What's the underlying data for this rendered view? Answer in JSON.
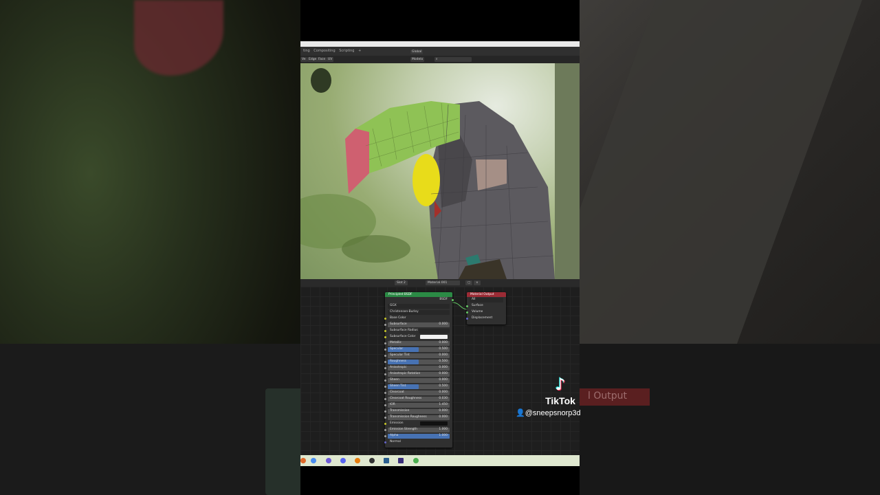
{
  "menubar": {
    "items": [
      "ting",
      "Compositing",
      "Scripting",
      "+"
    ]
  },
  "header": {
    "orientation": "Global",
    "snap": "Modelo",
    "modes": [
      "Ve",
      "Edge",
      "Face",
      "UV"
    ]
  },
  "node_header": {
    "slot": "Slot 2",
    "material": "Material.001"
  },
  "bsdf": {
    "title": "Principled BSDF",
    "output": "BSDF",
    "distribution": "GGX",
    "subsurface_method": "Christensen-Burley",
    "rows": [
      {
        "label": "Base Color",
        "kind": "label"
      },
      {
        "label": "Subsurface",
        "value": "0.000",
        "kind": "num"
      },
      {
        "label": "Subsurface Radius",
        "kind": "select"
      },
      {
        "label": "Subsurface Color",
        "kind": "color",
        "color": "#f2f2f2"
      },
      {
        "label": "Metallic",
        "value": "0.000",
        "kind": "num"
      },
      {
        "label": "Specular",
        "value": "0.500",
        "kind": "fill",
        "fill": 0.5
      },
      {
        "label": "Specular Tint",
        "value": "0.000",
        "kind": "num"
      },
      {
        "label": "Roughness",
        "value": "0.500",
        "kind": "fill",
        "fill": 0.5
      },
      {
        "label": "Anisotropic",
        "value": "0.000",
        "kind": "num"
      },
      {
        "label": "Anisotropic Rotation",
        "value": "0.000",
        "kind": "num"
      },
      {
        "label": "Sheen",
        "value": "0.000",
        "kind": "num"
      },
      {
        "label": "Sheen Tint",
        "value": "0.500",
        "kind": "fill",
        "fill": 0.5
      },
      {
        "label": "Clearcoat",
        "value": "0.000",
        "kind": "num"
      },
      {
        "label": "Clearcoat Roughness",
        "value": "0.030",
        "kind": "num"
      },
      {
        "label": "IOR",
        "value": "1.450",
        "kind": "num"
      },
      {
        "label": "Transmission",
        "value": "0.000",
        "kind": "num"
      },
      {
        "label": "Transmission Roughness",
        "value": "0.000",
        "kind": "num"
      },
      {
        "label": "Emission",
        "kind": "color",
        "color": "#111111"
      },
      {
        "label": "Emission Strength",
        "value": "1.000",
        "kind": "num"
      },
      {
        "label": "Alpha",
        "value": "1.000",
        "kind": "fill",
        "fill": 1.0
      },
      {
        "label": "Normal",
        "kind": "label"
      }
    ]
  },
  "material_output": {
    "title": "Material Output",
    "target": "All",
    "inputs": [
      "Surface",
      "Volume",
      "Displacement"
    ]
  },
  "overlay": {
    "brand": "TikTok",
    "handle": "@sneepsnorp3d",
    "logo_glyph": "♪"
  },
  "colors": {
    "bsdf_header": "#2b8a45",
    "output_header": "#9b2b35",
    "slider_fill": "#4772b3"
  }
}
